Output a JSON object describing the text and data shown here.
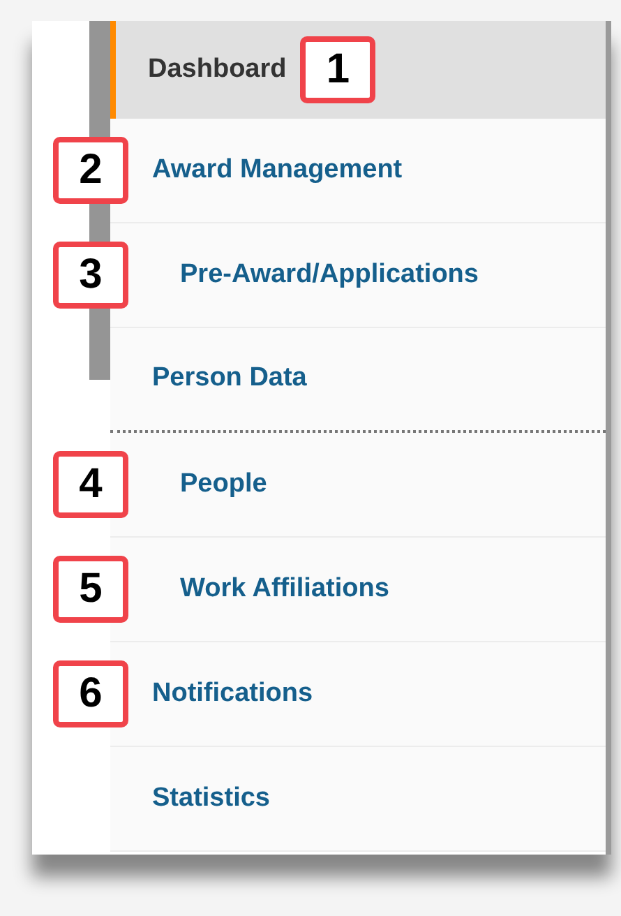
{
  "menu": [
    {
      "label": "Dashboard",
      "selected": true,
      "kind": "link",
      "callout": {
        "label": "1",
        "kind": "inline"
      }
    },
    {
      "label": "Award Management",
      "selected": false,
      "kind": "link",
      "callout": {
        "label": "2",
        "kind": "left"
      },
      "children": [
        {
          "label": "Pre-Award/Applications",
          "selected": false,
          "kind": "link",
          "callout": {
            "label": "3",
            "kind": "left"
          }
        }
      ]
    },
    {
      "label": "Person Data",
      "selected": false,
      "kind": "section",
      "children": [
        {
          "label": "People",
          "selected": false,
          "kind": "link",
          "callout": {
            "label": "4",
            "kind": "left"
          }
        },
        {
          "label": "Work Affiliations",
          "selected": false,
          "kind": "link",
          "callout": {
            "label": "5",
            "kind": "left"
          }
        }
      ]
    },
    {
      "label": "Notifications",
      "selected": false,
      "kind": "link",
      "callout": {
        "label": "6",
        "kind": "left"
      }
    },
    {
      "label": "Statistics",
      "selected": false,
      "kind": "link"
    }
  ]
}
